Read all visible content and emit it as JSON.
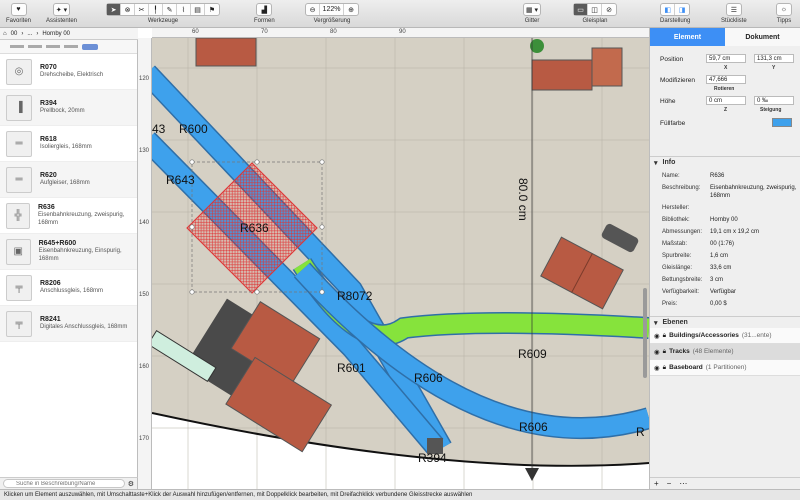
{
  "toolbar": {
    "favorites": "Favoriten",
    "assistants": "Assistenten",
    "tools": "Werkzeuge",
    "shapes": "Formen",
    "zoom": "Vergrößerung",
    "zoom_value": "122%",
    "grid": "Gitter",
    "trackplan": "Gleisplan",
    "display": "Darstellung",
    "partslist": "Stückliste",
    "tips": "Tipps"
  },
  "path": {
    "p1": "00",
    "p2": "...",
    "p3": "Hornby 00"
  },
  "library": [
    {
      "name": "R070",
      "desc": "Drehscheibe, Elektrisch"
    },
    {
      "name": "R394",
      "desc": "Prellbock, 20mm"
    },
    {
      "name": "R618",
      "desc": "Isoliergleis, 168mm"
    },
    {
      "name": "R620",
      "desc": "Aufgleiser, 168mm"
    },
    {
      "name": "R636",
      "desc": "Eisenbahnkreuzung, zweispurig, 168mm"
    },
    {
      "name": "R645+R600",
      "desc": "Eisenbahnkreuzung, Einspurig, 168mm"
    },
    {
      "name": "R8206",
      "desc": "Anschlussgleis, 168mm"
    },
    {
      "name": "R8241",
      "desc": "Digitales Anschlussgleis, 168mm"
    }
  ],
  "search": {
    "placeholder": "Suche in Beschreibung/Name"
  },
  "canvas": {
    "ruler_h": [
      "60",
      "70",
      "80",
      "90"
    ],
    "ruler_v": [
      "120",
      "130",
      "140",
      "150",
      "160",
      "170"
    ],
    "labels": {
      "r600": "R600",
      "r643": "R643",
      "r636": "R636",
      "r8072": "R8072",
      "r609": "R609",
      "r601": "R601",
      "r606a": "R606",
      "r606b": "R606",
      "r394": "R394",
      "r43": "43",
      "dim": "80.0 cm",
      "rp": "R"
    }
  },
  "panel": {
    "tab_element": "Element",
    "tab_document": "Dokument",
    "position_label": "Position",
    "pos_x": "59,7 cm",
    "pos_y": "131,3 cm",
    "x": "X",
    "y": "Y",
    "modify_label": "Modifizieren",
    "rotate_value": "47,666",
    "rotate": "Rotieren",
    "height_label": "Höhe",
    "z_value": "0 cm",
    "z": "Z",
    "slope_value": "0 ‰",
    "slope": "Steigung",
    "fill_label": "Füllfarbe",
    "info_header": "Info",
    "info": [
      {
        "k": "Name:",
        "v": "R636"
      },
      {
        "k": "Beschreibung:",
        "v": "Eisenbahnkreuzung, zweispurig, 168mm"
      },
      {
        "k": "Hersteller:",
        "v": ""
      },
      {
        "k": "Bibliothek:",
        "v": "Hornby 00"
      },
      {
        "k": "Abmessungen:",
        "v": "19,1 cm x 19,2 cm"
      },
      {
        "k": "Maßstab:",
        "v": "00  (1:76)"
      },
      {
        "k": "Spurbreite:",
        "v": "1,6 cm"
      },
      {
        "k": "Gleislänge:",
        "v": "33,6 cm"
      },
      {
        "k": "Bettungsbreite:",
        "v": "3 cm"
      },
      {
        "k": "Verfügbarkeit:",
        "v": "Verfügbar"
      },
      {
        "k": "Preis:",
        "v": "0,00 $"
      }
    ],
    "layers_header": "Ebenen",
    "layers": [
      {
        "name": "Buildings/Accessories",
        "count": "(31...ente)"
      },
      {
        "name": "Tracks",
        "count": "(48 Elemente)"
      },
      {
        "name": "Baseboard",
        "count": "(1 Partitionen)"
      }
    ]
  },
  "status": {
    "text": "Klicken um Element auszuwählen, mit Umschalttaste+Klick der Auswahl hinzufügen/entfernen, mit Doppelklick bearbeiten, mit Dreifachklick verbundene Gleisstrecke auswählen"
  },
  "colors": {
    "track": "#3ea1ec",
    "track_green": "#86e33c",
    "selection": "#e03434",
    "accent": "#3d8ff5",
    "board": "#d5d0c4",
    "roof": "#b85a43"
  }
}
